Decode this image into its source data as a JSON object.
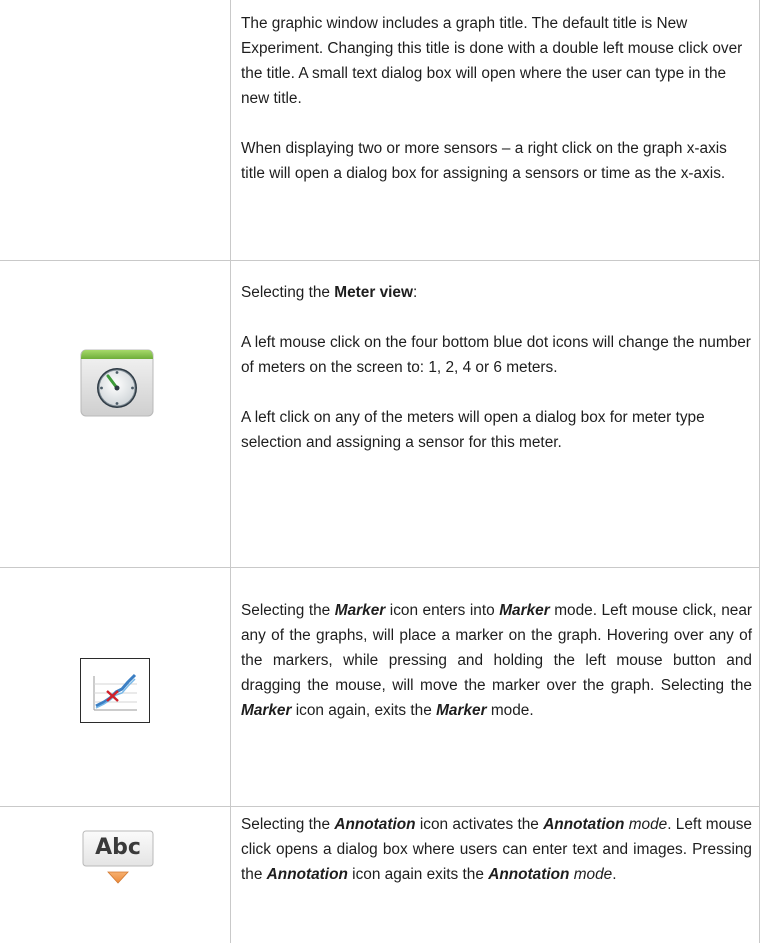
{
  "row1": {
    "para1": "The graphic window includes a graph title. The default title is New Experiment. Changing this title is done with a double left mouse click over the title. A small text dialog box will open where the user can type in the new title.",
    "para2": "When displaying two or more sensors – a right click on the graph x-axis title will open a dialog box for assigning a sensors or time as the x-axis."
  },
  "row2": {
    "icon": "meter-view-icon",
    "intro_text": "Selecting the ",
    "intro_bold": "Meter view",
    "intro_colon": ":",
    "para2": "A left mouse click on the four bottom blue dot icons will change the number of meters on the screen to: 1, 2, 4 or 6 meters.",
    "para3": "A left click on any of the meters will open a dialog box for meter type selection and assigning a sensor for this meter."
  },
  "row3": {
    "icon": "marker-icon",
    "t1": "Selecting the ",
    "b1": "Marker",
    "t2": " icon enters into ",
    "b2": "Marker",
    "t3": " mode. Left mouse click, near any of the graphs, will place a marker on the graph. Hovering over any of the markers, while pressing and holding the left mouse button and dragging the mouse, will move the marker over the graph. Selecting the ",
    "b3": "Marker",
    "t4": " icon again, exits the ",
    "b4": "Marker",
    "t5": " mode."
  },
  "row4": {
    "icon": "annotation-icon",
    "icon_text": "Abc",
    "t1": "Selecting the ",
    "b1": "Annotation",
    "t2": " icon activates the ",
    "b2": "Annotation",
    "i1": "mode",
    "t3": ". Left mouse click opens a dialog box where users can enter text and images. Pressing the ",
    "b3": "Annotation",
    "t4": " icon again exits the ",
    "b4": "Annotation",
    "i2": "mode",
    "t5": "."
  }
}
